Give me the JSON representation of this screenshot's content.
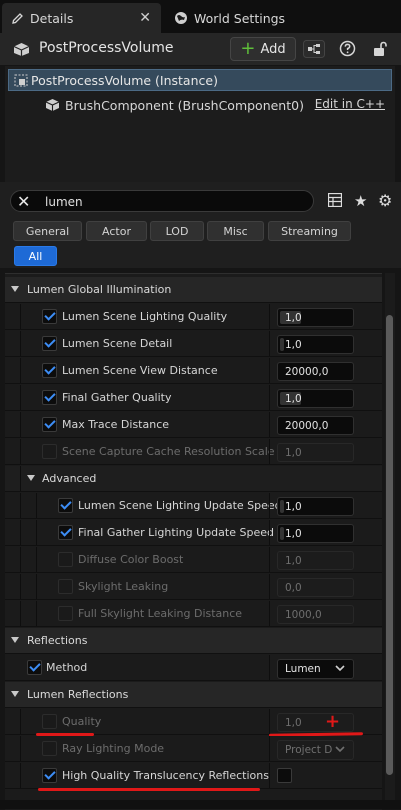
{
  "tabs": [
    {
      "label": "Details",
      "icon": "pencil-icon"
    },
    {
      "label": "World Settings",
      "icon": "globe-icon"
    }
  ],
  "header": {
    "actor_name": "PostProcessVolume",
    "add_label": "Add"
  },
  "tree": {
    "instance_label": "PostProcessVolume (Instance)",
    "brush_label": "BrushComponent (BrushComponent0)",
    "edit_link": "Edit in C++"
  },
  "search": {
    "value": "lumen"
  },
  "filters": [
    "General",
    "Actor",
    "LOD",
    "Misc",
    "Streaming",
    "All"
  ],
  "sections": {
    "gi": "Lumen Global Illumination",
    "advanced": "Advanced",
    "reflections": "Reflections",
    "lumen_reflections": "Lumen Reflections"
  },
  "gi_props": [
    {
      "label": "Lumen Scene Lighting Quality",
      "value": "1,0",
      "checked": true,
      "enabled": true,
      "fill": 0.3
    },
    {
      "label": "Lumen Scene Detail",
      "value": "1,0",
      "checked": true,
      "enabled": true,
      "fill": 0.05
    },
    {
      "label": "Lumen Scene View Distance",
      "value": "20000,0",
      "checked": true,
      "enabled": true,
      "fill": 0
    },
    {
      "label": "Final Gather Quality",
      "value": "1,0",
      "checked": true,
      "enabled": true,
      "fill": 0.3
    },
    {
      "label": "Max Trace Distance",
      "value": "20000,0",
      "checked": true,
      "enabled": true,
      "fill": 0
    },
    {
      "label": "Scene Capture Cache Resolution Scale",
      "value": "1,0",
      "checked": false,
      "enabled": false,
      "fill": 0
    }
  ],
  "advanced_props": [
    {
      "label": "Lumen Scene Lighting Update Speed",
      "value": "1,0",
      "checked": true,
      "enabled": true,
      "fill": 0.05
    },
    {
      "label": "Final Gather Lighting Update Speed",
      "value": "1,0",
      "checked": true,
      "enabled": true,
      "fill": 0.05
    },
    {
      "label": "Diffuse Color Boost",
      "value": "1,0",
      "checked": false,
      "enabled": false,
      "fill": 0
    },
    {
      "label": "Skylight Leaking",
      "value": "0,0",
      "checked": false,
      "enabled": false,
      "fill": 0
    },
    {
      "label": "Full Skylight Leaking Distance",
      "value": "1000,0",
      "checked": false,
      "enabled": false,
      "fill": 0
    }
  ],
  "method": {
    "label": "Method",
    "value": "Lumen",
    "checked": true
  },
  "lumen_reflection_props": {
    "quality": {
      "label": "Quality",
      "value": "1,0",
      "checked": false,
      "enabled": false
    },
    "ray_lighting": {
      "label": "Ray Lighting Mode",
      "value": "Project D",
      "checked": false,
      "enabled": false
    },
    "hq_translucency": {
      "label": "High Quality Translucency Reflections",
      "checked": true,
      "enabled": true
    }
  },
  "colors": {
    "accent": "#1e6ad6",
    "check": "#3d8df5",
    "annotation_red": "#e01818",
    "add_plus": "#5fbf3a"
  }
}
